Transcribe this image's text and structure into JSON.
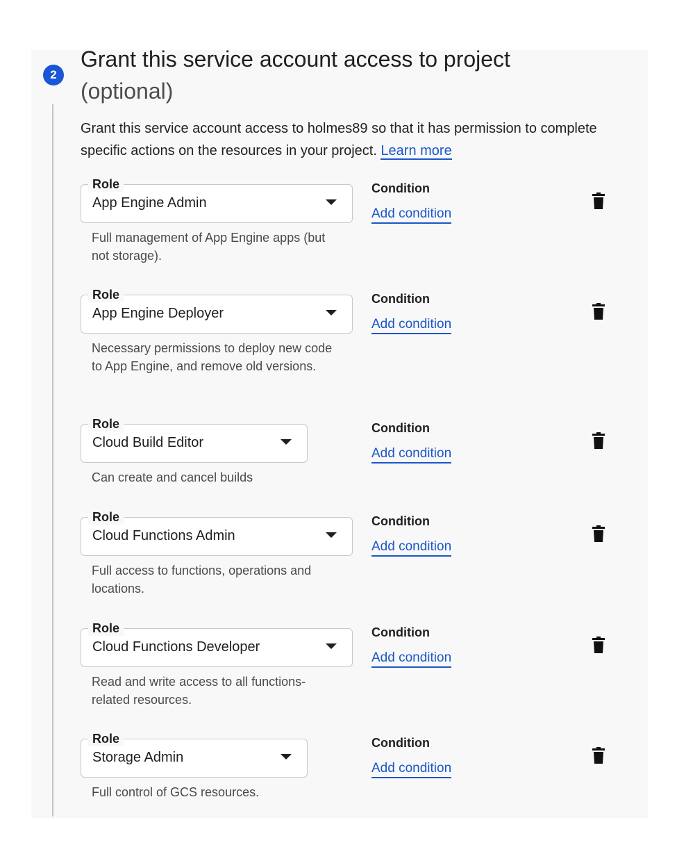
{
  "step": {
    "number": "2",
    "title": "Grant this service account access to project",
    "optional": "(optional)",
    "description": "Grant this service account access to holmes89 so that it has permission to complete specific actions on the resources in your project.",
    "learn_more": "Learn more"
  },
  "roles": [
    {
      "legend": "Role",
      "value": "App Engine Admin",
      "helper": "Full management of App Engine apps (but not storage).",
      "condition_label": "Condition",
      "condition_link": "Add condition"
    },
    {
      "legend": "Role",
      "value": "App Engine Deployer",
      "helper": "Necessary permissions to deploy new code to App Engine, and remove old versions.",
      "condition_label": "Condition",
      "condition_link": "Add condition"
    },
    {
      "legend": "Role",
      "value": "Cloud Build Editor",
      "helper": "Can create and cancel builds",
      "condition_label": "Condition",
      "condition_link": "Add condition"
    },
    {
      "legend": "Role",
      "value": "Cloud Functions Admin",
      "helper": "Full access to functions, operations and locations.",
      "condition_label": "Condition",
      "condition_link": "Add condition"
    },
    {
      "legend": "Role",
      "value": "Cloud Functions Developer",
      "helper": "Read and write access to all functions-related resources.",
      "condition_label": "Condition",
      "condition_link": "Add condition"
    },
    {
      "legend": "Role",
      "value": "Storage Admin",
      "helper": "Full control of GCS resources.",
      "condition_label": "Condition",
      "condition_link": "Add condition"
    }
  ],
  "icons": {
    "delete": "trash-icon",
    "dropdown": "caret-down-icon"
  },
  "colors": {
    "accent": "#1a56d6",
    "link": "#1a56c8",
    "panel_background": "#f8f8f8"
  }
}
